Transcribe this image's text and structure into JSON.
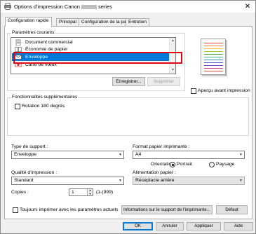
{
  "window": {
    "title_prefix": "Options d'impression Canon",
    "title_suffix": "series",
    "close_symbol": "✕"
  },
  "tabs": [
    {
      "label": "Configuration rapide",
      "active": true
    },
    {
      "label": "Principal",
      "active": false
    },
    {
      "label": "Configuration de la page",
      "active": false
    },
    {
      "label": "Entretien",
      "active": false
    }
  ],
  "current_settings": {
    "label": "Paramètres courants",
    "items": [
      {
        "label": "Document commercial",
        "icon": "document-icon"
      },
      {
        "label": "Économie de papier",
        "icon": "paper-saving-icon"
      },
      {
        "label": "Enveloppe",
        "icon": "envelope-icon"
      },
      {
        "label": "Carte de vœux",
        "icon": "greeting-card-icon"
      }
    ],
    "selected_index": 2,
    "save_button": "Enregistrer...",
    "delete_button": "Supprimer"
  },
  "preview": {
    "label": "Aperçu avant impression",
    "checked": false
  },
  "additional": {
    "label": "Fonctionnalités supplémentaires",
    "rotate_label": "Rotation 180 degrés",
    "rotate_checked": false
  },
  "media_type": {
    "label": "Type de support :",
    "value": "Enveloppe"
  },
  "paper_size": {
    "label": "Format papier imprimante :",
    "value": "A4"
  },
  "orientation": {
    "label": "Orientation :",
    "portrait": "Portrait",
    "landscape": "Paysage",
    "selected": "Portrait"
  },
  "quality": {
    "label": "Qualité d'impression :",
    "value": "Standard"
  },
  "paper_source": {
    "label": "Alimentation papier :",
    "value": "Réceptacle arrière"
  },
  "copies": {
    "label": "Copies :",
    "value": "1",
    "range": "(1-(999)"
  },
  "always_print": {
    "label": "Toujours imprimer avec les paramètres actuels",
    "checked": false
  },
  "media_info_button": "Informations sur le support de l'imprimante...",
  "default_button": "Défaut",
  "footer": {
    "ok": "OK",
    "cancel": "Annuler",
    "apply": "Appliquer",
    "help": "Aide"
  },
  "colors": {
    "accent": "#0078d7",
    "highlight_box": "#e60012"
  }
}
